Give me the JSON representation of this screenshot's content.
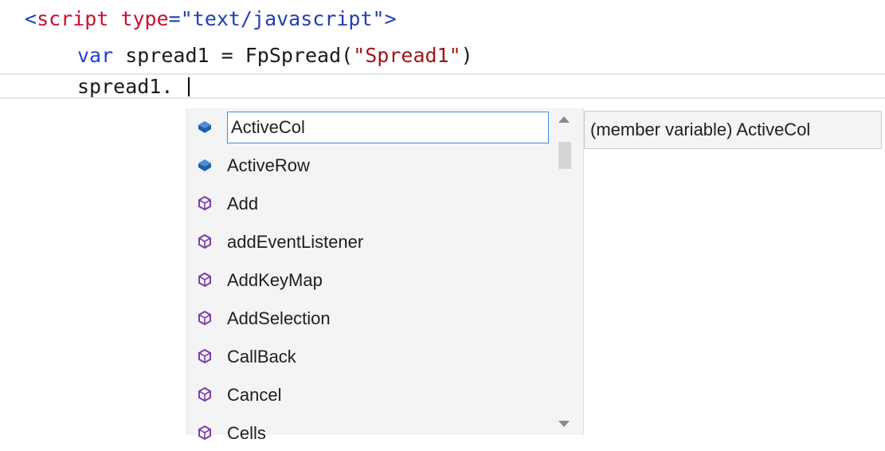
{
  "editor": {
    "line1": {
      "lt": "<",
      "tag": "script",
      "attr": "type",
      "eq": "=",
      "value": "\"text/javascript\"",
      "gt": ">"
    },
    "line2": {
      "keyword": "var",
      "before": " spread1 = FpSpread(",
      "string": "\"Spread1\"",
      "after": ")"
    },
    "line3": {
      "text": "spread1."
    }
  },
  "completion": {
    "items": [
      {
        "label": "ActiveCol",
        "icon": "member-variable-icon",
        "selected": true
      },
      {
        "label": "ActiveRow",
        "icon": "member-variable-icon"
      },
      {
        "label": "Add",
        "icon": "method-icon"
      },
      {
        "label": "addEventListener",
        "icon": "method-icon"
      },
      {
        "label": "AddKeyMap",
        "icon": "method-icon"
      },
      {
        "label": "AddSelection",
        "icon": "method-icon"
      },
      {
        "label": "CallBack",
        "icon": "method-icon"
      },
      {
        "label": "Cancel",
        "icon": "method-icon"
      },
      {
        "label": "Cells",
        "icon": "method-icon"
      }
    ]
  },
  "tooltip": {
    "text": "(member variable) ActiveCol"
  },
  "colors": {
    "selection_border": "#3d8ee0",
    "method_icon": "#7b3fa8",
    "member_icon": "#1c5fa8"
  }
}
